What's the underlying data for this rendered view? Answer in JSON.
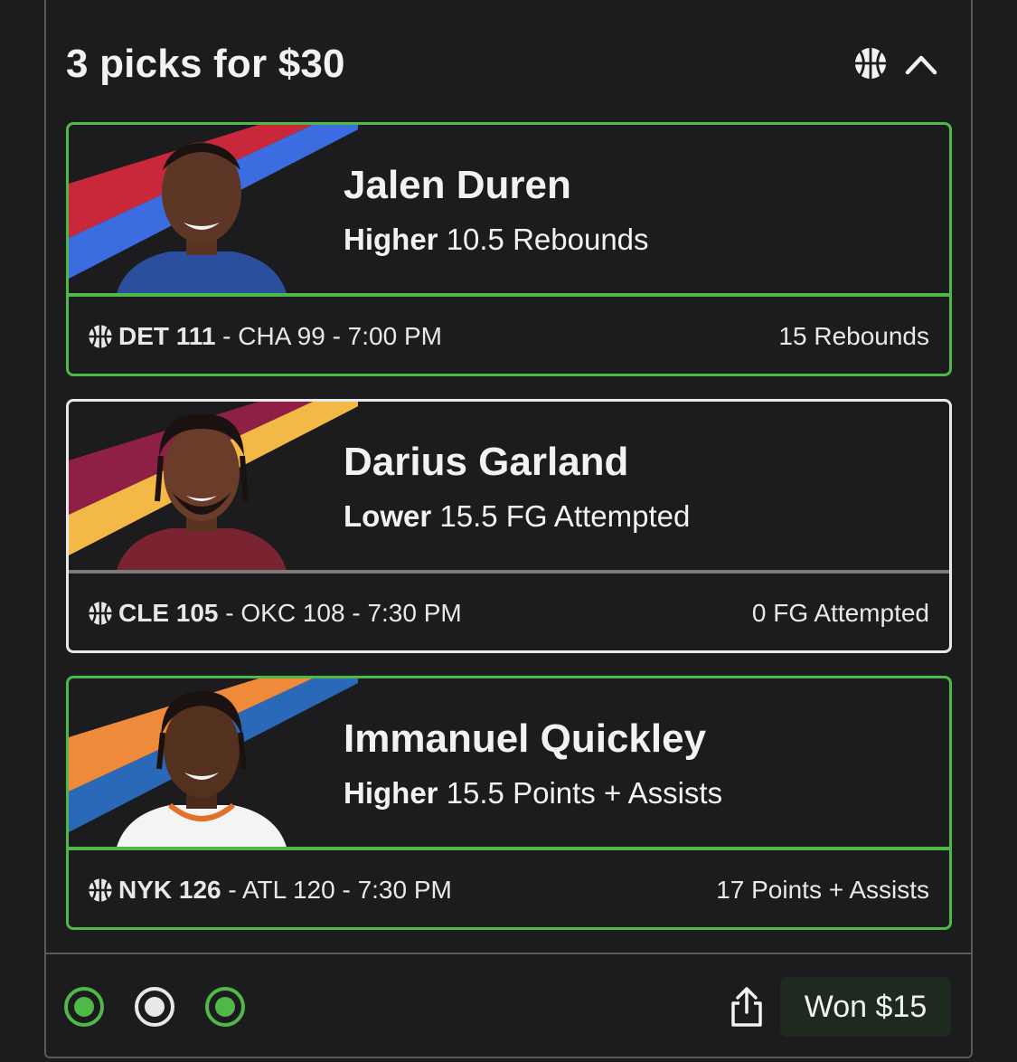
{
  "header": {
    "title": "3 picks for $30",
    "sport_icon": "basketball-icon",
    "toggle_icon": "chevron-up-icon"
  },
  "colors": {
    "win_green": "#4fb948",
    "pending_white": "#e8e8e8",
    "background": "#1c1c1e"
  },
  "picks": [
    {
      "name": "Jalen Duren",
      "direction": "Higher",
      "line": "10.5 Rebounds",
      "team": "DET 111",
      "game_rest": " - CHA 99 - 7:00 PM",
      "result": "15 Rebounds",
      "status": "win",
      "stripe_colors": [
        "#c8283a",
        "#3b6de0"
      ]
    },
    {
      "name": "Darius Garland",
      "direction": "Lower",
      "line": "15.5 FG Attempted",
      "team": "CLE 105",
      "game_rest": " - OKC 108 - 7:30 PM",
      "result": "0 FG Attempted",
      "status": "pending",
      "stripe_colors": [
        "#8e1f45",
        "#f3b845"
      ]
    },
    {
      "name": "Immanuel Quickley",
      "direction": "Higher",
      "line": "15.5 Points + Assists",
      "team": "NYK 126",
      "game_rest": " - ATL 120 - 7:30 PM",
      "result": "17 Points + Assists",
      "status": "win",
      "stripe_colors": [
        "#ef8a3b",
        "#2a68b8"
      ]
    }
  ],
  "footer": {
    "share_icon": "share-icon",
    "won_label": "Won $15"
  }
}
